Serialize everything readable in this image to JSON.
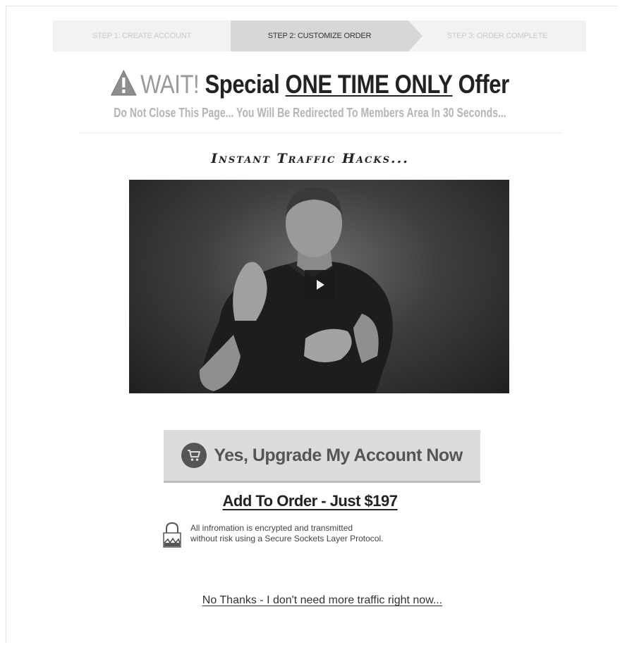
{
  "steps": [
    {
      "label": "Step 1: Create Account",
      "active": false
    },
    {
      "label": "Step 2: Customize Order",
      "active": true
    },
    {
      "label": "Step 3: Order Complete",
      "active": false
    }
  ],
  "headline": {
    "wait": "WAIT!",
    "special": "Special",
    "once": "ONE TIME ONLY",
    "offer": "Offer"
  },
  "subheadline": "Do Not Close This Page... You Will Be Redirected To Members Area In 30 Seconds...",
  "video_title": "Instant Traffic Hacks...",
  "video": {
    "play_icon": "play-icon"
  },
  "cta": {
    "label": "Yes, Upgrade My Account Now",
    "icon": "cart-icon"
  },
  "price_link": "Add To Order - Just $197",
  "secure_note": "All infromation is encrypted and transmitted\nwithout risk using a Secure Sockets Layer Protocol.",
  "decline_link": "No Thanks - I don't need more traffic right now...",
  "colors": {
    "accent_gray": "#9a9a9a",
    "step_active": "#d7d7d7",
    "steps_bg": "#f2f2f2",
    "cta_bg": "#dcdcdc"
  }
}
